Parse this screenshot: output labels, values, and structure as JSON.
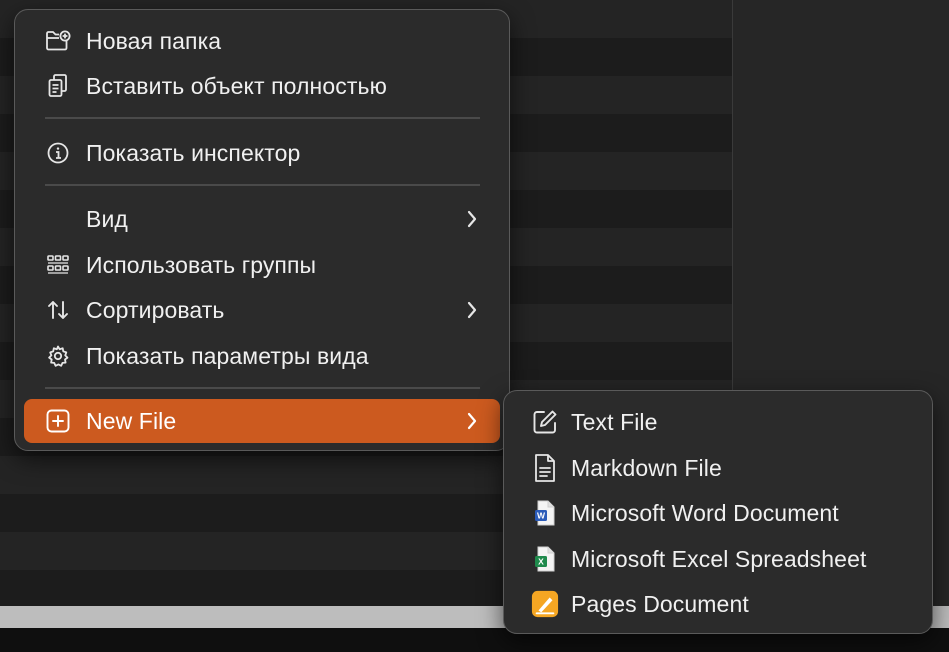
{
  "context_menu": {
    "items": [
      {
        "label": "Новая папка",
        "icon": "new-folder-icon"
      },
      {
        "label": "Вставить объект полностью",
        "icon": "paste-icon"
      },
      {
        "label": "Показать инспектор",
        "icon": "info-icon"
      },
      {
        "label": "Вид",
        "icon": "",
        "has_submenu": true
      },
      {
        "label": "Использовать группы",
        "icon": "grid-icon"
      },
      {
        "label": "Сортировать",
        "icon": "sort-arrows-icon",
        "has_submenu": true
      },
      {
        "label": "Показать параметры вида",
        "icon": "gear-icon"
      },
      {
        "label": "New File",
        "icon": "plus-square-icon",
        "has_submenu": true,
        "highlighted": true
      }
    ]
  },
  "submenu": {
    "items": [
      {
        "label": "Text File",
        "icon": "pencil-edit-icon"
      },
      {
        "label": "Markdown File",
        "icon": "document-icon"
      },
      {
        "label": "Microsoft Word Document",
        "icon": "word-file-icon"
      },
      {
        "label": "Microsoft Excel Spreadsheet",
        "icon": "excel-file-icon"
      },
      {
        "label": "Pages Document",
        "icon": "pages-app-icon"
      }
    ]
  },
  "colors": {
    "menu_bg": "#2b2b2b",
    "highlight": "#cc5a1f",
    "word_blue": "#2b5bb8",
    "excel_green": "#1f8a4c",
    "pages_orange": "#f5a623"
  }
}
